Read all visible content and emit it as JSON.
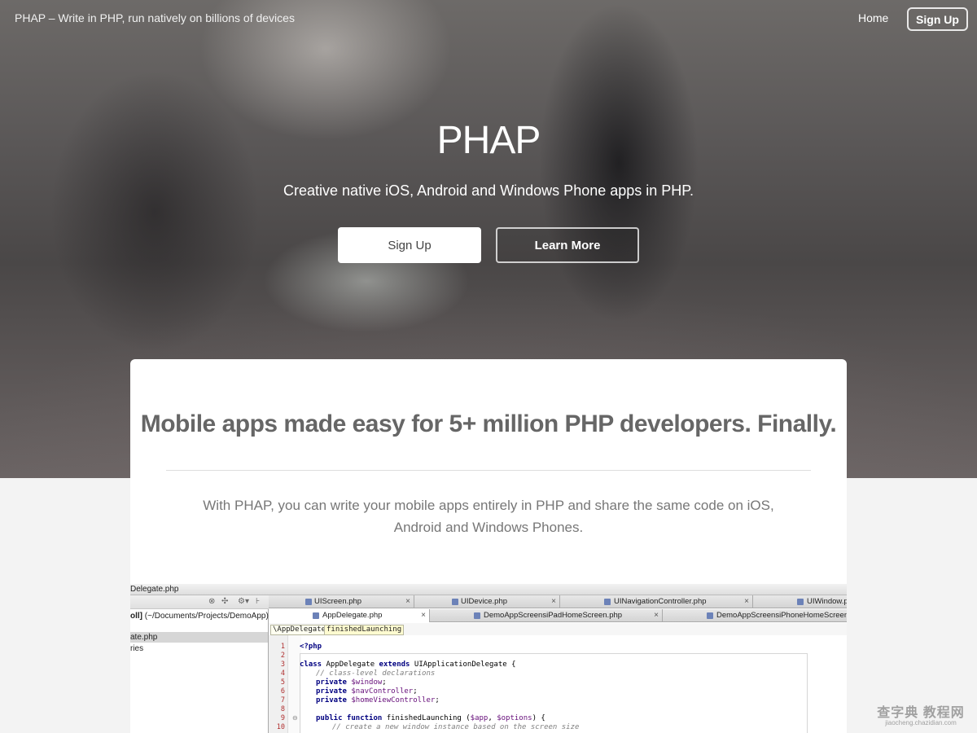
{
  "nav": {
    "brand": "PHAP – Write in PHP, run natively on billions of devices",
    "home": "Home",
    "signup": "Sign Up"
  },
  "hero": {
    "title": "PHAP",
    "subtitle": "Creative native iOS, Android and Windows Phone apps in PHP.",
    "btn_signup": "Sign Up",
    "btn_learn": "Learn More"
  },
  "card": {
    "title": "Mobile apps made easy for 5+ million PHP developers. Finally.",
    "text": "With PHAP, you can write your mobile apps entirely in PHP and share the same code on iOS, Android and Windows Phones."
  },
  "ide": {
    "crumb": "Delegate.php",
    "project_name": "oll]",
    "project_path": "(~/Documents/Projects/DemoApp)",
    "files": [
      "ate.php",
      "ries"
    ],
    "tabs_row1": [
      "UIScreen.php",
      "UIDevice.php",
      "UINavigationController.php",
      "UIWindow.ph"
    ],
    "tabs_row2": [
      "AppDelegate.php",
      "DemoAppScreensiPadHomeScreen.php",
      "DemoAppScreensiPhoneHomeScreen.ph"
    ],
    "structure": [
      "\\AppDelegate",
      "finishedLaunching"
    ],
    "line_numbers": [
      "1",
      "2",
      "3",
      "4",
      "5",
      "6",
      "7",
      "8",
      "9",
      "10"
    ],
    "code": {
      "l1": "<?php",
      "l3_kw1": "class",
      "l3_name": " AppDelegate ",
      "l3_kw2": "extends",
      "l3_rest": " UIApplicationDelegate {",
      "l4": "// class-level declarations",
      "l5_kw": "private",
      "l5_var": " $window",
      "l6_kw": "private",
      "l6_var": " $navController",
      "l7_kw": "private",
      "l7_var": " $homeViewController",
      "l9_kw1": "public",
      "l9_kw2": " function",
      "l9_name": " finishedLaunching (",
      "l9_var1": "$app",
      "l9_sep": ", ",
      "l9_var2": "$options",
      "l9_end": ") {",
      "l10": "// create a new window instance based on the screen size"
    }
  },
  "watermark": {
    "main": "查字典 教程网",
    "sub": "jiaocheng.chazidian.com"
  }
}
